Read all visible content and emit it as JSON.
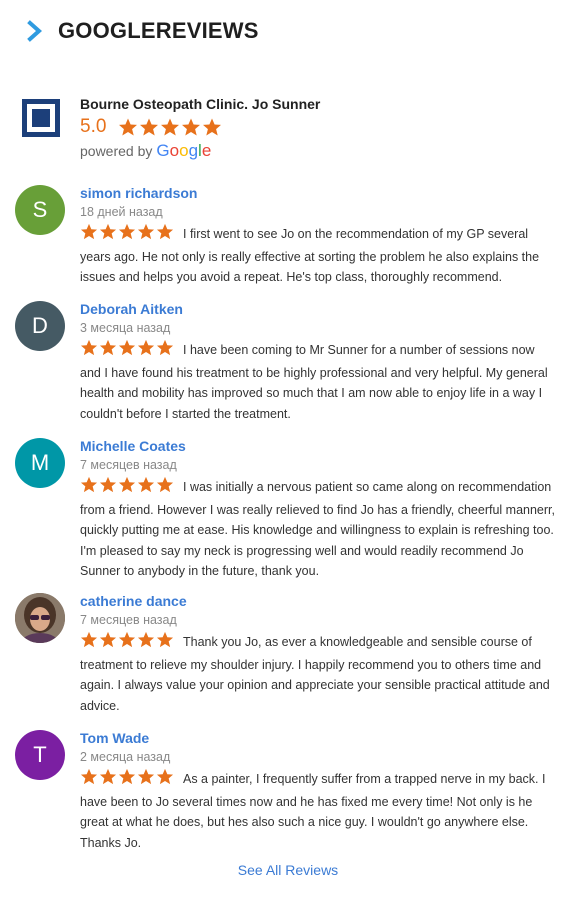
{
  "header": {
    "title": "GOOGLEREVIEWS"
  },
  "place": {
    "name": "Bourne Osteopath Clinic. Jo Sunner",
    "rating": "5.0",
    "stars": 5,
    "powered_by": "powered by",
    "google_letters": [
      "G",
      "o",
      "o",
      "g",
      "l",
      "e"
    ]
  },
  "colors": {
    "accent_star": "#e7711b",
    "link": "#3b7bd4",
    "chevron": "#2f9be0"
  },
  "reviews": [
    {
      "author": "simon richardson",
      "initial": "S",
      "avatar_color": "#689f38",
      "time": "18 дней назад",
      "stars": 5,
      "text": "I first went to see Jo on the recommendation of my GP several years ago. He not only is really effective at sorting the problem he also explains the issues and helps you avoid a repeat. He's top class, thoroughly recommend."
    },
    {
      "author": "Deborah Aitken",
      "initial": "D",
      "avatar_color": "#455a64",
      "time": "3 месяца назад",
      "stars": 5,
      "text": "I have been coming to Mr Sunner for a number of sessions now and I have found his treatment to be highly professional and very helpful. My general health and mobility has improved so much that I am now able to enjoy life in a way I couldn't before I started the treatment."
    },
    {
      "author": "Michelle Coates",
      "initial": "M",
      "avatar_color": "#0097a7",
      "time": "7 месяцев назад",
      "stars": 5,
      "text": "I was initially a nervous patient so came along on recommendation from a friend. However I was really relieved to find Jo has a friendly, cheerful mannerr, quickly putting me at ease. His knowledge and willingness to explain is refreshing too. I'm pleased to say my neck is progressing well and would readily recommend Jo Sunner to anybody in the future, thank you."
    },
    {
      "author": "catherine dance",
      "initial": "",
      "avatar_color": "#6d5a4a",
      "time": "7 месяцев назад",
      "stars": 5,
      "text": "Thank you Jo, as ever a knowledgeable and sensible course of treatment to relieve my shoulder injury. I  happily recommend you to others time and again. I always value your opinion and appreciate your sensible practical attitude and advice."
    },
    {
      "author": "Tom Wade",
      "initial": "T",
      "avatar_color": "#7b1fa2",
      "time": "2 месяца назад",
      "stars": 5,
      "text": "As a painter, I frequently suffer from a trapped nerve in my back. I have been to Jo several times now and he has fixed me every time! Not only is he great at what he does, but hes also such a nice guy. I wouldn't go anywhere else. Thanks Jo."
    }
  ],
  "footer": {
    "see_all": "See All Reviews"
  }
}
